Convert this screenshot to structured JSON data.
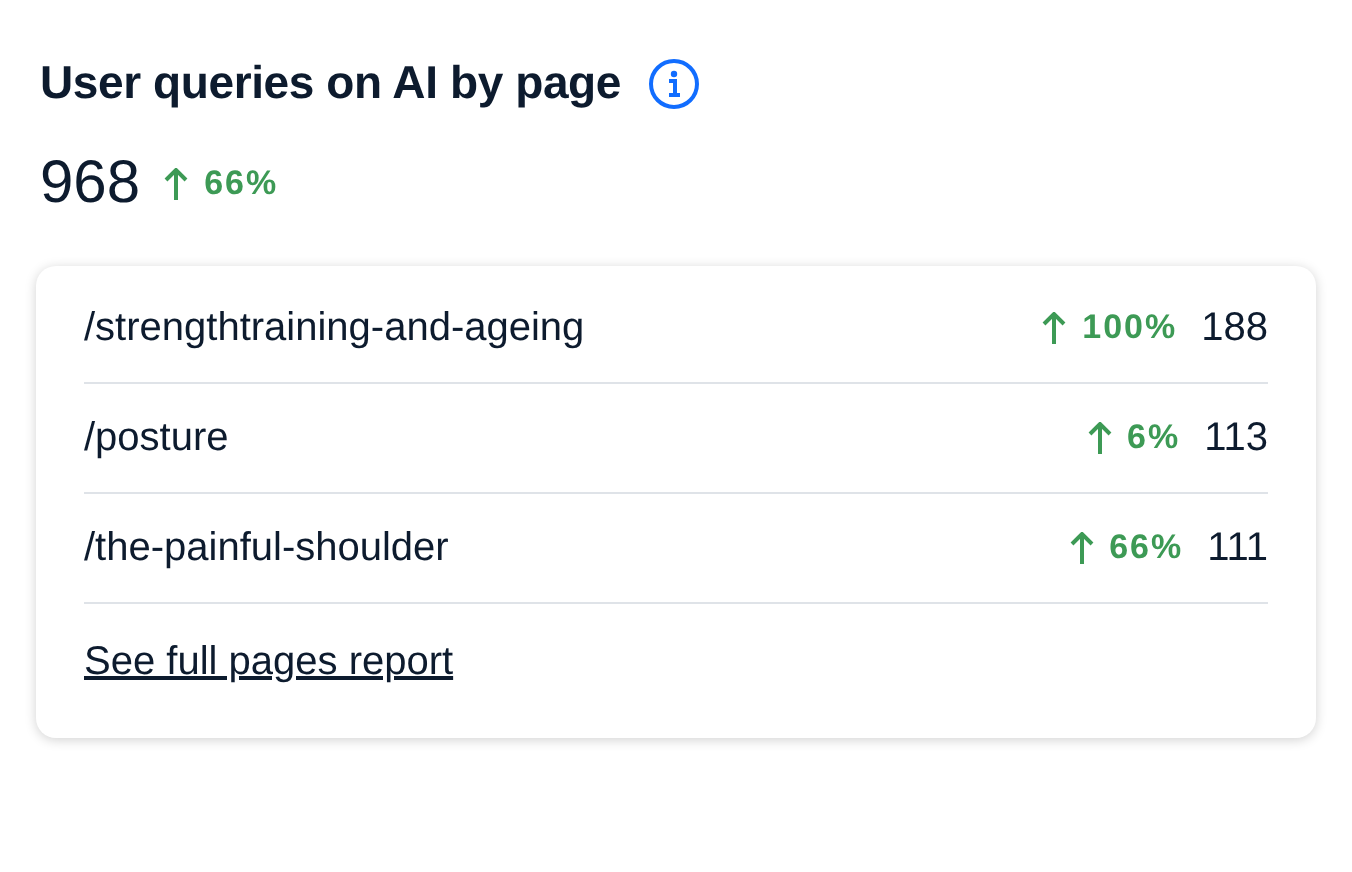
{
  "title": "User queries on AI by page",
  "total": {
    "value": "968",
    "rising": true,
    "change": "66%"
  },
  "rows": [
    {
      "page": "/strengthtraining-and-ageing",
      "rising": true,
      "change": "100%",
      "count": "188"
    },
    {
      "page": "/posture",
      "rising": true,
      "change": "6%",
      "count": "113"
    },
    {
      "page": "/the-painful-shoulder",
      "rising": true,
      "change": "66%",
      "count": "111"
    }
  ],
  "link": "See full pages report"
}
